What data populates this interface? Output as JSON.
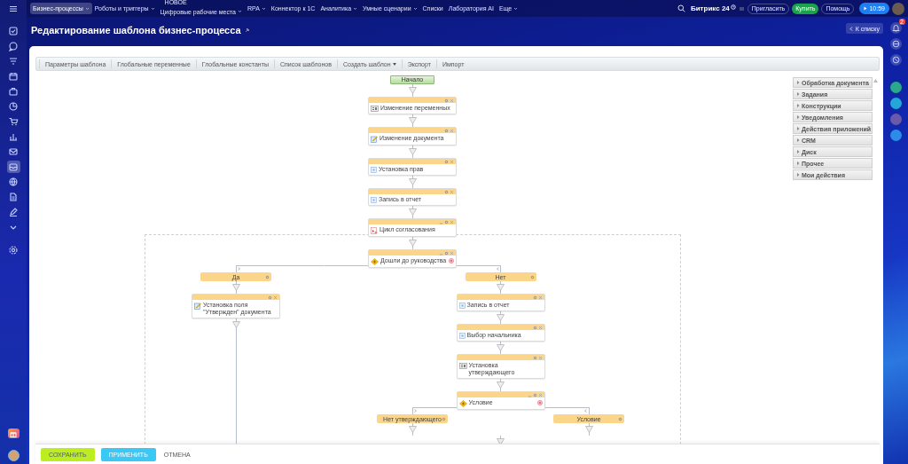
{
  "top_nav": {
    "items": [
      {
        "label": "Бизнес-процессы",
        "selected": true,
        "dropdown": true
      },
      {
        "label": "Роботы и триггеры",
        "selected": false,
        "dropdown": true
      },
      {
        "label": "Цифровые рабочие места",
        "selected": false,
        "dropdown": true,
        "badge": "НОВОЕ"
      },
      {
        "label": "RPA",
        "selected": false,
        "dropdown": true
      },
      {
        "label": "Коннектор к 1С",
        "selected": false,
        "dropdown": false
      },
      {
        "label": "Аналитика",
        "selected": false,
        "dropdown": true
      },
      {
        "label": "Умные сценарии",
        "selected": false,
        "dropdown": true
      },
      {
        "label": "Списки",
        "selected": false,
        "dropdown": false
      },
      {
        "label": "Лаборатория AI",
        "selected": false,
        "dropdown": false
      },
      {
        "label": "Еще",
        "selected": false,
        "dropdown": true
      }
    ],
    "brand": "Битрикс 24",
    "buttons": [
      {
        "label": "Пригласить",
        "kind": "outline"
      },
      {
        "label": "Купить",
        "kind": "buy"
      },
      {
        "label": "Помощь",
        "kind": "outline"
      }
    ],
    "timer": "10:59"
  },
  "sidebar": {
    "items": [
      {
        "selected": false
      },
      {
        "selected": false
      },
      {
        "selected": false
      },
      {
        "selected": false
      },
      {
        "selected": false
      },
      {
        "selected": false
      },
      {
        "selected": false
      },
      {
        "selected": false
      },
      {
        "selected": false
      },
      {
        "selected": true
      },
      {
        "selected": false
      },
      {
        "selected": false
      },
      {
        "selected": false
      },
      {
        "selected": false
      },
      {
        "selected": false
      }
    ]
  },
  "right_bar": {
    "notification_count": "2"
  },
  "page": {
    "title": "Редактирование шаблона бизнес-процесса",
    "back_button": "К списку"
  },
  "toolbar": [
    {
      "label": "Параметры шаблона",
      "dropdown": false
    },
    {
      "label": "Глобальные переменные",
      "dropdown": false
    },
    {
      "label": "Глобальные константы",
      "dropdown": false
    },
    {
      "label": "Список шаблонов",
      "dropdown": false
    },
    {
      "label": "Создать шаблон",
      "dropdown": true
    },
    {
      "label": "Экспорт",
      "dropdown": false
    },
    {
      "label": "Импорт",
      "dropdown": false
    }
  ],
  "diagram": {
    "sequence": [
      {
        "kind": "start",
        "label": "Начало"
      },
      {
        "kind": "set-variable",
        "label": "Изменение переменных"
      },
      {
        "kind": "edit-document",
        "label": "Изменение документа"
      },
      {
        "kind": "action",
        "label": "Установка прав"
      },
      {
        "kind": "action",
        "label": "Запись в отчет"
      },
      {
        "kind": "loop",
        "label": "Цикл согласования",
        "children": [
          {
            "kind": "condition",
            "label": "Дошли до руководства",
            "branches": [
              {
                "label": "Да",
                "children": [
                  {
                    "kind": "edit-document",
                    "label": "Установка поля \"Утвержден\" документа"
                  }
                ]
              },
              {
                "label": "Нет",
                "children": [
                  {
                    "kind": "action",
                    "label": "Запись в отчет"
                  },
                  {
                    "kind": "action",
                    "label": "Выбор начальника"
                  },
                  {
                    "kind": "set-variable",
                    "label": "Установка утверждающего"
                  },
                  {
                    "kind": "condition",
                    "label": "Условие",
                    "branches": [
                      {
                        "label": "Нет утверждающего"
                      },
                      {
                        "label": "Условие"
                      }
                    ]
                  }
                ]
              }
            ]
          }
        ]
      }
    ]
  },
  "palette": [
    {
      "label": "Обработка документа",
      "expanded": false
    },
    {
      "label": "Задания",
      "expanded": false
    },
    {
      "label": "Конструкции",
      "expanded": false
    },
    {
      "label": "Уведомления",
      "expanded": false
    },
    {
      "label": "Действия приложений",
      "expanded": false
    },
    {
      "label": "CRM",
      "expanded": false
    },
    {
      "label": "Диск",
      "expanded": false
    },
    {
      "label": "Прочее",
      "expanded": false
    },
    {
      "label": "Мои действия",
      "expanded": false
    }
  ],
  "footer": {
    "buttons": [
      {
        "label": "СОХРАНИТЬ",
        "kind": "save"
      },
      {
        "label": "ПРИМЕНИТЬ",
        "kind": "apply"
      },
      {
        "label": "ОТМЕНА",
        "kind": "link"
      }
    ]
  }
}
